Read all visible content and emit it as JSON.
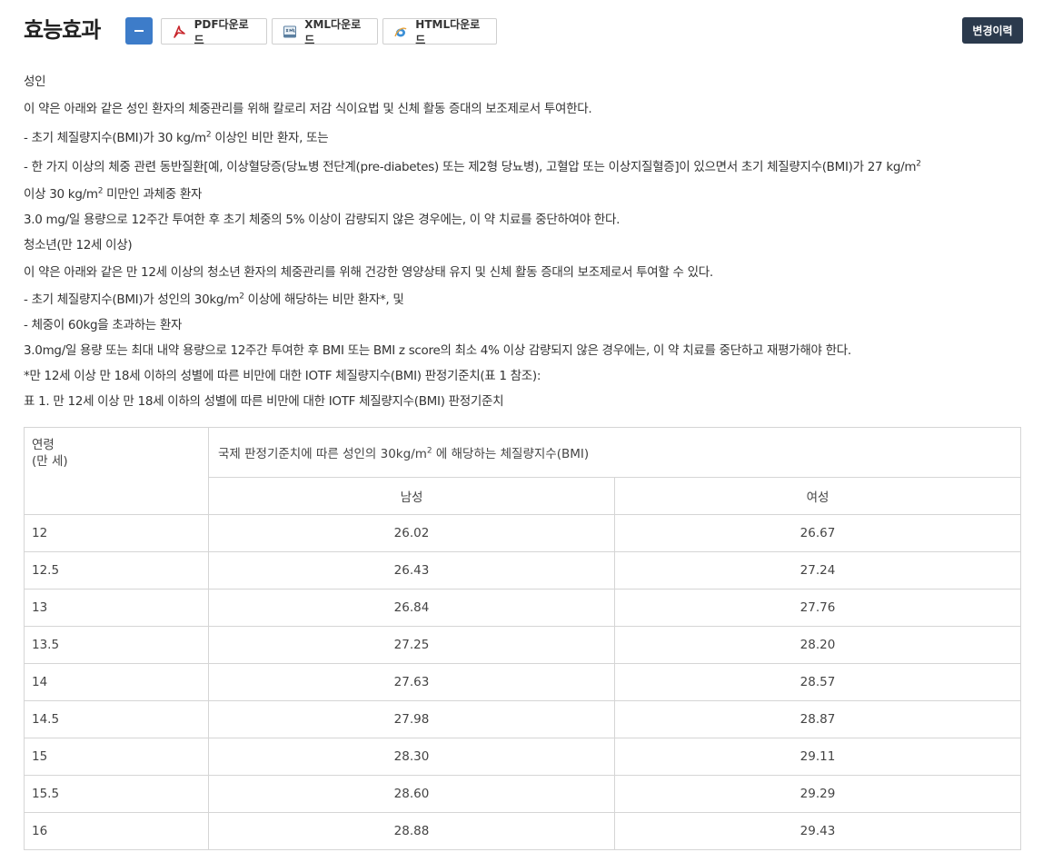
{
  "header": {
    "title": "효능효과",
    "collapse_label": "−",
    "pdf_label": "PDF다운로드",
    "xml_label": "XML다운로드",
    "html_label": "HTML다운로드",
    "history_label": "변경이력"
  },
  "content": {
    "adult_heading": "성인",
    "adult_intro": "이 약은 아래와 같은 성인 환자의 체중관리를 위해 칼로리 저감 식이요법 및 신체 활동 증대의 보조제로서 투여한다.",
    "adult_b1_pre": "- 초기 체질량지수(BMI)가 30 kg/m",
    "adult_b1_sup": "2",
    "adult_b1_post": " 이상인 비만 환자, 또는",
    "adult_b2_pre": "- 한 가지 이상의 체중 관련 동반질환[예, 이상혈당증(당뇨병 전단계(pre-diabetes) 또는 제2형 당뇨병), 고혈압 또는 이상지질혈증]이 있으면서 초기 체질량지수(BMI)가 27 kg/m",
    "adult_b2_sup": "2",
    "adult_b3_pre": "이상 30 kg/m",
    "adult_b3_sup": "2",
    "adult_b3_post": " 미만인 과체중 환자",
    "adult_stop": "3.0 mg/일 용량으로 12주간 투여한 후 초기 체중의 5% 이상이 감량되지 않은 경우에는, 이 약 치료를 중단하여야 한다.",
    "teen_heading": "청소년(만 12세 이상)",
    "teen_intro": "이 약은 아래와 같은 만 12세 이상의 청소년 환자의 체중관리를 위해 건강한 영양상태 유지 및 신체 활동 증대의 보조제로서 투여할 수 있다.",
    "teen_b1_pre": "- 초기 체질량지수(BMI)가 성인의 30kg/m",
    "teen_b1_sup": "2",
    "teen_b1_post": " 이상에 해당하는 비만 환자*, 및",
    "teen_b2": "- 체중이 60kg을 초과하는 환자",
    "teen_stop": "3.0mg/일 용량 또는 최대 내약 용량으로 12주간 투여한 후 BMI 또는 BMI z score의 최소 4% 이상 감량되지 않은 경우에는, 이 약 치료를 중단하고 재평가해야 한다.",
    "footnote": "*만 12세 이상 만 18세 이하의 성별에 따른 비만에 대한 IOTF 체질량지수(BMI) 판정기준치(표 1 참조):",
    "table_caption": "표 1. 만 12세 이상 만 18세 이하의 성별에 따른 비만에 대한 IOTF 체질량지수(BMI) 판정기준치"
  },
  "table": {
    "age_header_line1": "연령",
    "age_header_line2": "(만 세)",
    "group_header_pre": "국제 판정기준치에 따른 성인의 30kg/m",
    "group_header_sup": "2",
    "group_header_post": " 에 해당하는 체질량지수(BMI)",
    "male_header": "남성",
    "female_header": "여성",
    "rows": [
      {
        "age": "12",
        "male": "26.02",
        "female": "26.67"
      },
      {
        "age": "12.5",
        "male": "26.43",
        "female": "27.24"
      },
      {
        "age": "13",
        "male": "26.84",
        "female": "27.76"
      },
      {
        "age": "13.5",
        "male": "27.25",
        "female": "28.20"
      },
      {
        "age": "14",
        "male": "27.63",
        "female": "28.57"
      },
      {
        "age": "14.5",
        "male": "27.98",
        "female": "28.87"
      },
      {
        "age": "15",
        "male": "28.30",
        "female": "29.11"
      },
      {
        "age": "15.5",
        "male": "28.60",
        "female": "29.29"
      },
      {
        "age": "16",
        "male": "28.88",
        "female": "29.43"
      }
    ]
  },
  "icons": {
    "pdf": "pdf-icon",
    "xml": "xml-icon",
    "html": "html-icon"
  },
  "colors": {
    "toggle": "#3d7cc9",
    "history": "#2b3a4d",
    "pdf_icon": "#c8272d"
  }
}
